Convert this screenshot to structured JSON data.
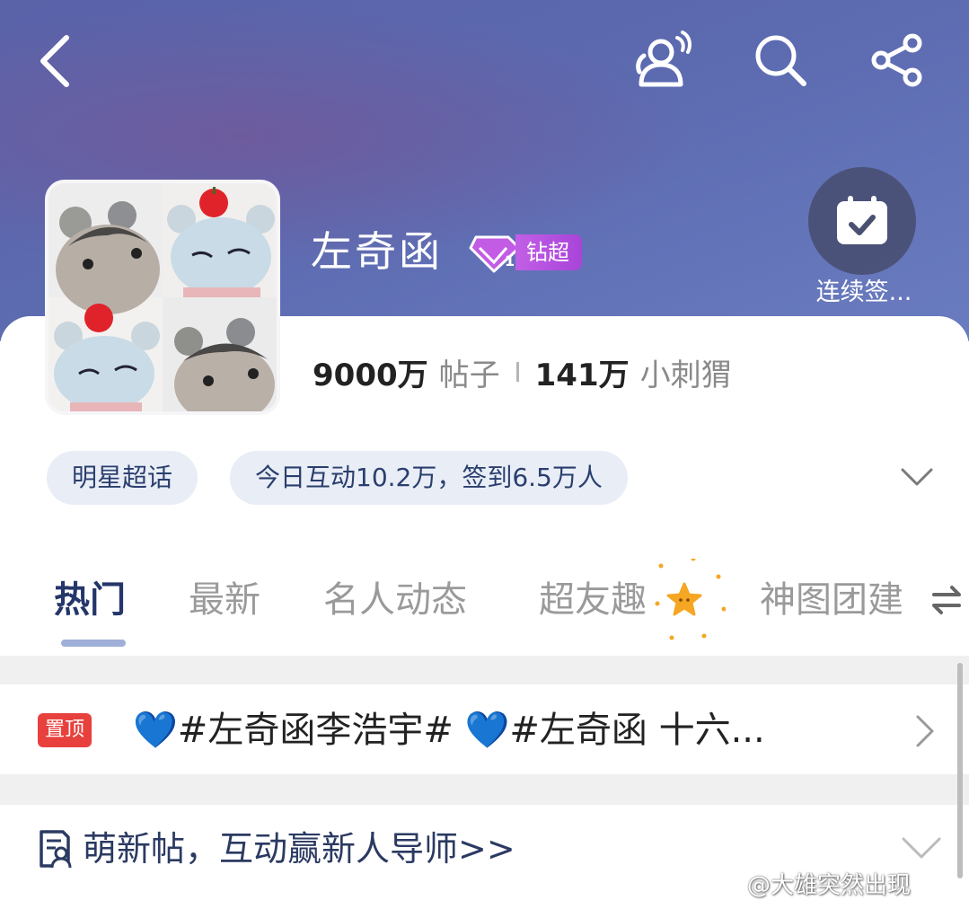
{
  "header": {
    "title": "左奇函",
    "badge_label": "钻超",
    "signin_label": "连续签..."
  },
  "stats": {
    "posts_count": "9000万",
    "posts_label": "帖子",
    "fans_count": "141万",
    "fans_label": "小刺猬"
  },
  "chips": {
    "category": "明星超话",
    "activity": "今日互动10.2万，签到6.5万人"
  },
  "tabs": [
    {
      "label": "热门",
      "active": true
    },
    {
      "label": "最新",
      "active": false
    },
    {
      "label": "名人动态",
      "active": false
    },
    {
      "label": "超友趣",
      "active": false
    },
    {
      "label": "神图团建",
      "active": false
    }
  ],
  "pinned": {
    "tag": "置顶",
    "text": "💙#左奇函李浩宇# 💙#左奇函 十六..."
  },
  "notice": {
    "text": "萌新帖，互动赢新人导师>>"
  },
  "watermark": "@大雄突然出现",
  "icons": [
    "back-arrow-icon",
    "interaction-icon",
    "search-icon",
    "share-icon",
    "calendar-check-icon",
    "diamond-icon",
    "chevron-down-icon",
    "swap-icon",
    "star-icon",
    "chevron-right-icon",
    "document-user-icon"
  ],
  "colors": {
    "header_bg": "#5c6ab0",
    "active_tab": "#24366a",
    "pin_tag": "#e8413d",
    "badge": "#b650df",
    "chip_bg": "#e8edf6",
    "star": "#f5a623"
  }
}
